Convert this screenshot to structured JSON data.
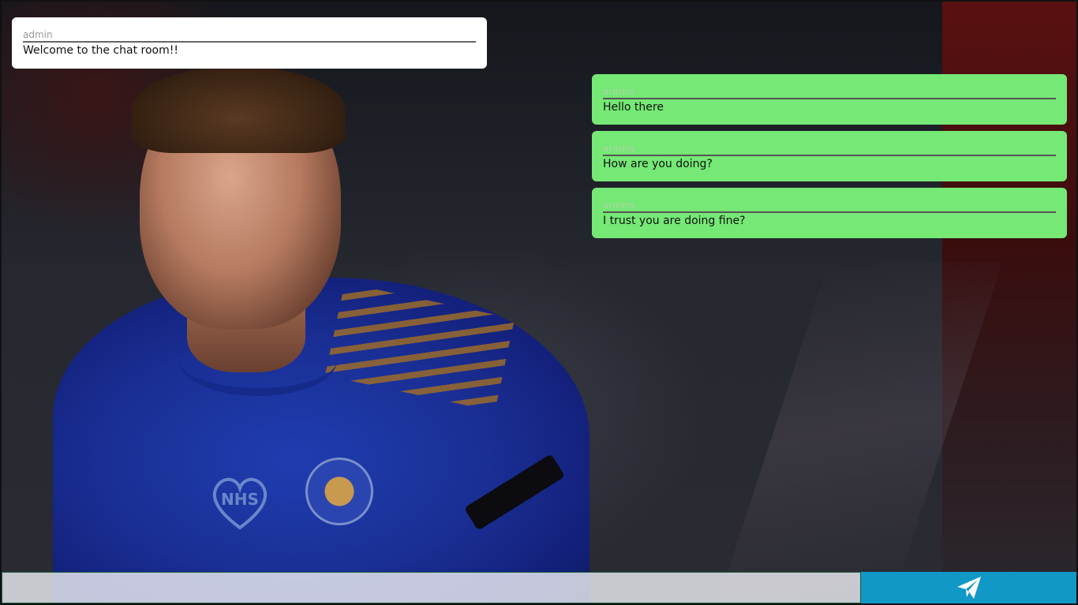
{
  "messages": [
    {
      "sender": "admin",
      "text": "Welcome to the chat room!!"
    },
    {
      "sender": "aramis",
      "text": "Hello there"
    },
    {
      "sender": "aramis",
      "text": "How are you doing?"
    },
    {
      "sender": "aramis",
      "text": "I trust you are doing fine?"
    }
  ],
  "background": {
    "nhs_text": "NHS"
  },
  "composer": {
    "placeholder": "",
    "send_icon": "paper-plane-icon"
  },
  "colors": {
    "admin_bubble": "#ffffff",
    "user_bubble": "#75e875",
    "send_button": "#1098c6"
  }
}
